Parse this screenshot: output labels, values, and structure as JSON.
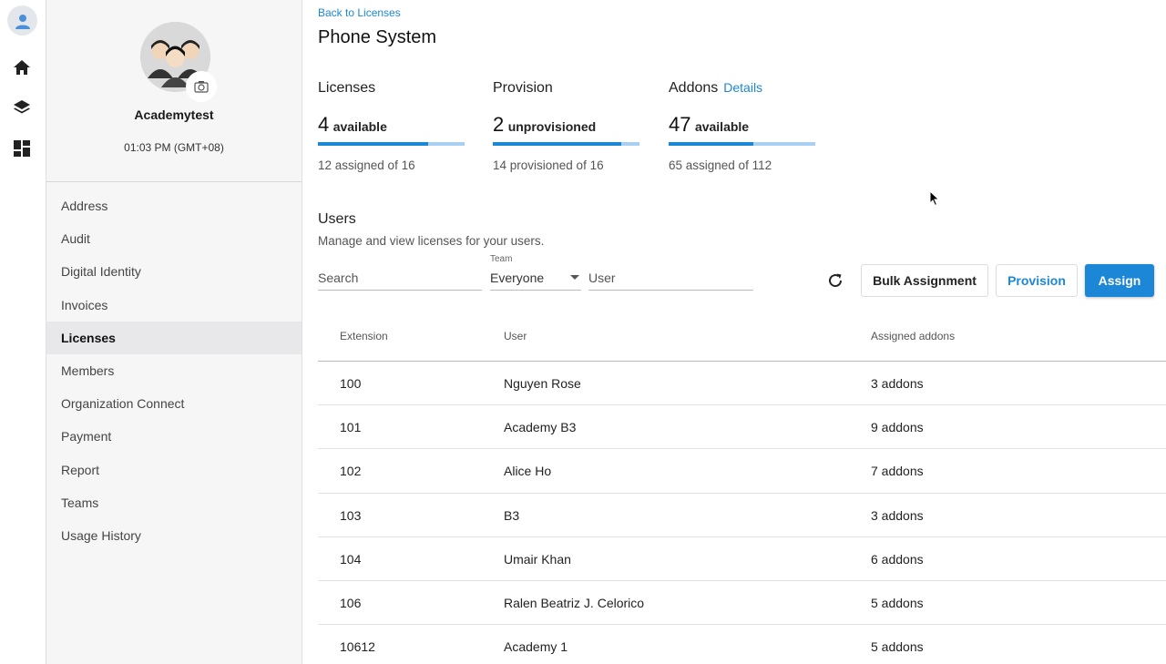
{
  "rail": {
    "icons": [
      "user-avatar-icon",
      "home-icon",
      "layers-icon",
      "dashboard-icon"
    ]
  },
  "org": {
    "name": "Academytest",
    "time": "01:03 PM (GMT+08)",
    "menu": [
      {
        "label": "Address"
      },
      {
        "label": "Audit"
      },
      {
        "label": "Digital Identity"
      },
      {
        "label": "Invoices"
      },
      {
        "label": "Licenses",
        "active": true
      },
      {
        "label": "Members"
      },
      {
        "label": "Organization Connect"
      },
      {
        "label": "Payment"
      },
      {
        "label": "Report"
      },
      {
        "label": "Teams"
      },
      {
        "label": "Usage History"
      }
    ]
  },
  "main": {
    "back_link": "Back to Licenses",
    "title": "Phone System",
    "stats": [
      {
        "label": "Licenses",
        "num": "4",
        "unit": "available",
        "sub": "12 assigned of 16",
        "progress": 0.75
      },
      {
        "label": "Provision",
        "num": "2",
        "unit": "unprovisioned",
        "sub": "14 provisioned of 16",
        "progress": 0.875
      },
      {
        "label": "Addons",
        "details": "Details",
        "num": "47",
        "unit": "available",
        "sub": "65 assigned of 112",
        "progress": 0.58
      }
    ],
    "users_title": "Users",
    "users_desc": "Manage and view licenses for your users.",
    "filters": {
      "search_placeholder": "Search",
      "team_label": "Team",
      "team_value": "Everyone",
      "user_placeholder": "User"
    },
    "buttons": {
      "bulk": "Bulk Assignment",
      "provision": "Provision",
      "assign": "Assign"
    },
    "accent": "#1d87d7",
    "table": {
      "headers": [
        "Extension",
        "User",
        "Assigned addons"
      ],
      "rows": [
        [
          "100",
          "Nguyen Rose",
          "3 addons"
        ],
        [
          "101",
          "Academy B3",
          "9 addons"
        ],
        [
          "102",
          "Alice Ho",
          "7 addons"
        ],
        [
          "103",
          "B3",
          "3 addons"
        ],
        [
          "104",
          "Umair Khan",
          "6 addons"
        ],
        [
          "106",
          "Ralen Beatriz J. Celorico",
          "5 addons"
        ],
        [
          "10612",
          "Academy 1",
          "5 addons"
        ]
      ]
    }
  }
}
